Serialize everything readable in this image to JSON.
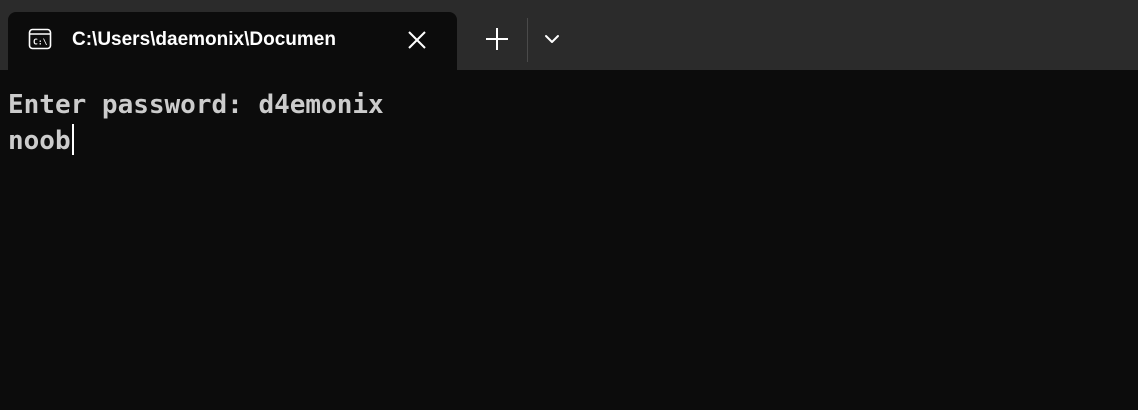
{
  "tabs": [
    {
      "title": "C:\\Users\\daemonix\\Documen",
      "icon": "console-icon",
      "active": true
    }
  ],
  "tabbar": {
    "new_tab_icon": "plus-icon",
    "dropdown_icon": "chevron-down-icon",
    "close_icon": "close-icon"
  },
  "terminal": {
    "lines": [
      "Enter password: d4emonix",
      "noob"
    ]
  },
  "colors": {
    "tabbar_bg": "#2b2b2b",
    "terminal_bg": "#0c0c0c",
    "text": "#cccccc",
    "tab_title": "#ffffff"
  }
}
